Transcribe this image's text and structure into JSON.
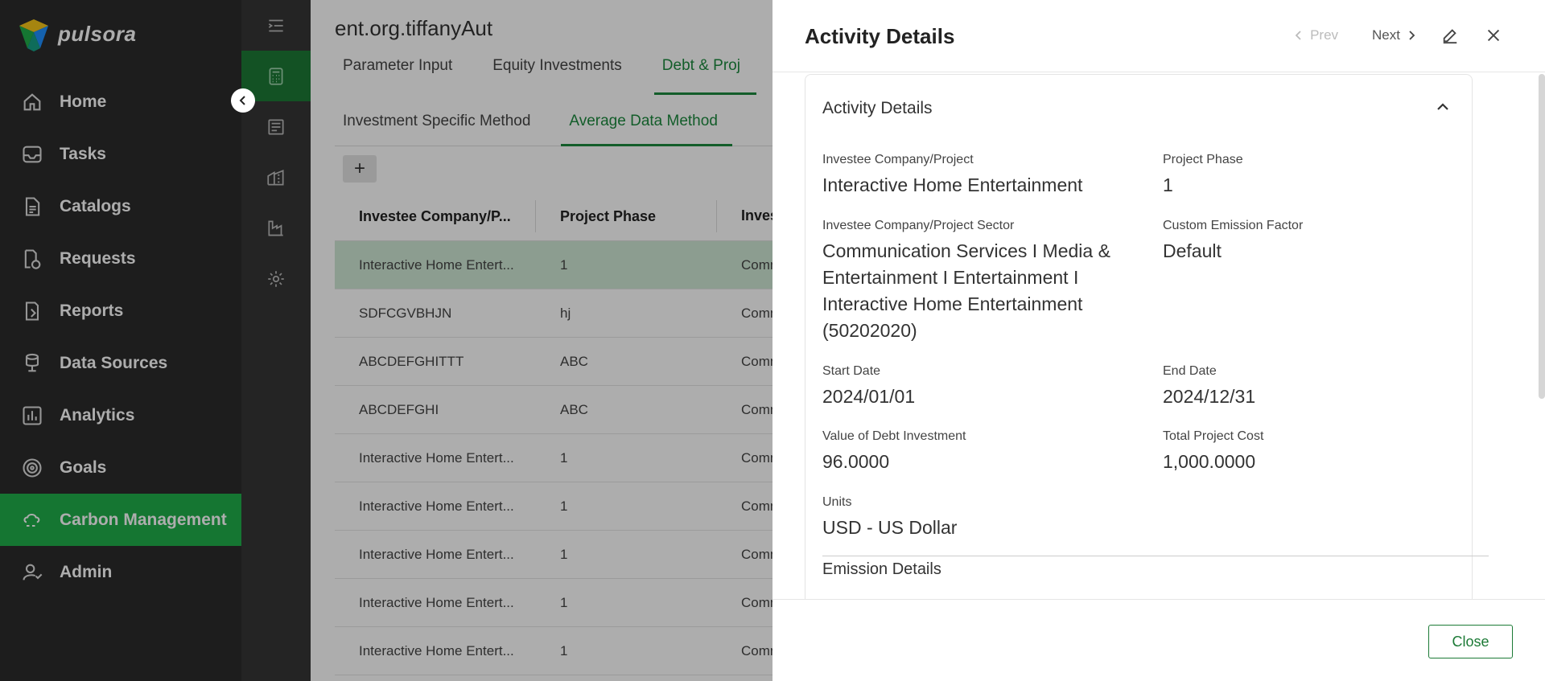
{
  "app": {
    "name": "pulsora"
  },
  "nav": [
    {
      "label": "Home",
      "icon": "home-icon"
    },
    {
      "label": "Tasks",
      "icon": "inbox-icon"
    },
    {
      "label": "Catalogs",
      "icon": "document-icon"
    },
    {
      "label": "Requests",
      "icon": "request-icon"
    },
    {
      "label": "Reports",
      "icon": "report-icon"
    },
    {
      "label": "Data Sources",
      "icon": "database-icon"
    },
    {
      "label": "Analytics",
      "icon": "chart-icon"
    },
    {
      "label": "Goals",
      "icon": "target-icon"
    },
    {
      "label": "Carbon Management",
      "icon": "cloud-co2-icon",
      "active": true
    },
    {
      "label": "Admin",
      "icon": "user-settings-icon"
    }
  ],
  "main": {
    "title": "ent.org.tiffanyAut",
    "tabs": [
      "Parameter Input",
      "Equity Investments",
      "Debt & Proj"
    ],
    "subtabs": [
      "Investment Specific Method",
      "Average Data Method"
    ],
    "add_label": "+",
    "columns": [
      "Investee Company/P...",
      "Project Phase",
      "Inves"
    ],
    "rows": [
      [
        "Interactive Home Entert...",
        "1",
        "Comm"
      ],
      [
        "SDFCGVBHJN",
        "hj",
        "Comm"
      ],
      [
        "ABCDEFGHITTT",
        "ABC",
        "Comm"
      ],
      [
        "ABCDEFGHI",
        "ABC",
        "Comm"
      ],
      [
        "Interactive Home Entert...",
        "1",
        "Comm"
      ],
      [
        "Interactive Home Entert...",
        "1",
        "Comm"
      ],
      [
        "Interactive Home Entert...",
        "1",
        "Comm"
      ],
      [
        "Interactive Home Entert...",
        "1",
        "Comm"
      ],
      [
        "Interactive Home Entert...",
        "1",
        "Comm"
      ]
    ]
  },
  "drawer": {
    "title": "Activity Details",
    "prev_label": "Prev",
    "next_label": "Next",
    "section_title": "Activity Details",
    "fields": {
      "investee_label": "Investee Company/Project",
      "investee_value": "Interactive Home Entertainment",
      "phase_label": "Project Phase",
      "phase_value": "1",
      "sector_label": "Investee Company/Project Sector",
      "sector_value": "Communication Services I Media & Entertainment I Entertainment I Interactive Home Entertainment (50202020)",
      "emission_factor_label": "Custom Emission Factor",
      "emission_factor_value": "Default",
      "start_label": "Start Date",
      "start_value": "2024/01/01",
      "end_label": "End Date",
      "end_value": "2024/12/31",
      "debt_label": "Value of Debt Investment",
      "debt_value": "96.0000",
      "cost_label": "Total Project Cost",
      "cost_value": "1,000.0000",
      "units_label": "Units",
      "units_value": "USD - US Dollar"
    },
    "section2_title": "Emission Details",
    "close_label": "Close"
  },
  "colors": {
    "accent": "#1fae4b",
    "sidebar": "#2b2b2b",
    "rail": "#363636"
  }
}
